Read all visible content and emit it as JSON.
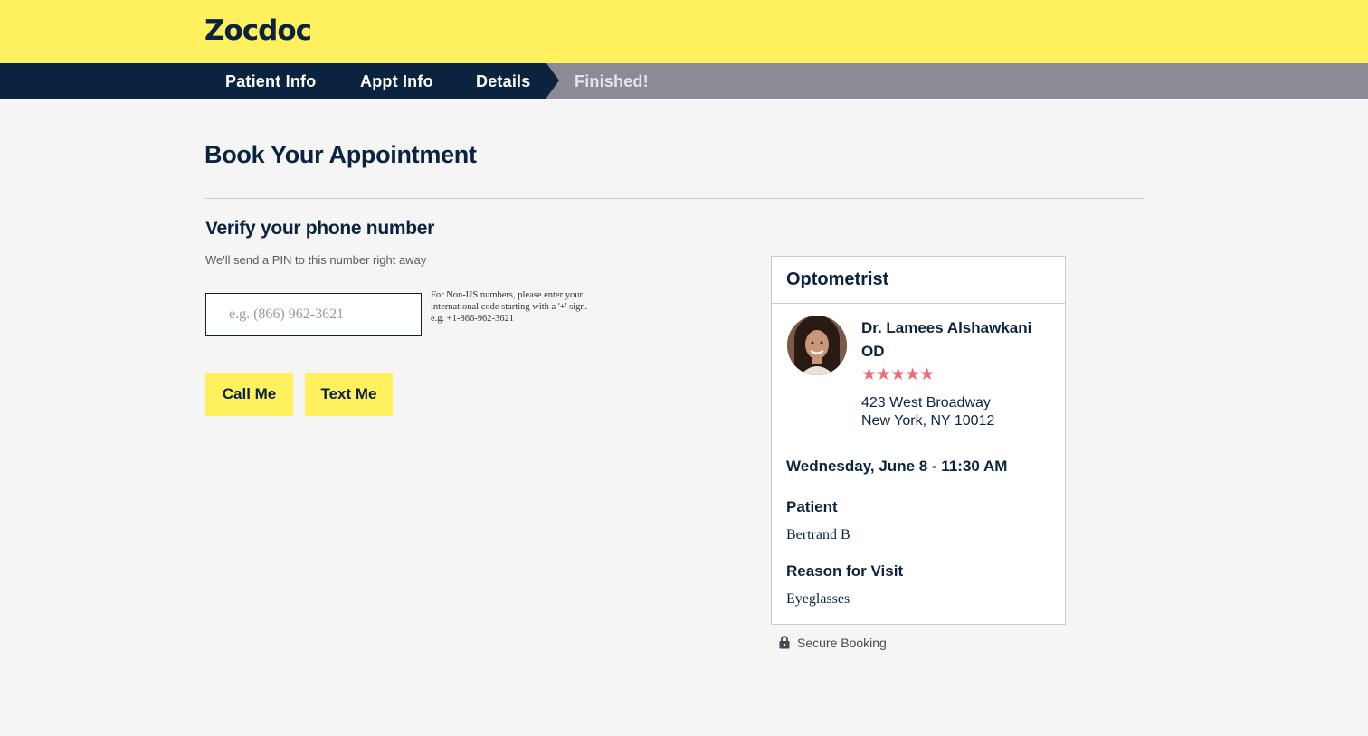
{
  "header": {
    "logo": "Zocdoc",
    "brand_color": "#fff05e"
  },
  "steps": [
    {
      "label": "Patient Info",
      "state": "done"
    },
    {
      "label": "Appt Info",
      "state": "done"
    },
    {
      "label": "Details",
      "state": "current"
    },
    {
      "label": "Finished!",
      "state": "upcoming"
    }
  ],
  "main": {
    "title": "Book Your Appointment",
    "verify": {
      "heading": "Verify your phone number",
      "subtext": "We'll send a PIN to this number right away",
      "phone": {
        "value": "",
        "placeholder": "e.g. (866) 962-3621"
      },
      "note_lines": [
        "For Non-US numbers, please enter your",
        "international code starting with a '+' sign.",
        "e.g. +1-866-962-3621"
      ],
      "call_button": "Call Me",
      "text_button": "Text Me"
    }
  },
  "card": {
    "specialty": "Optometrist",
    "doctor_name": "Dr. Lamees Alshawkani OD",
    "rating": 5,
    "stars": "★★★★★",
    "address_line1": "423 West Broadway",
    "address_line2": "New York, NY 10012",
    "appointment": "Wednesday, June 8 - 11:30 AM",
    "patient_label": "Patient",
    "patient_name": "Bertrand B",
    "reason_label": "Reason for Visit",
    "reason": "Eyeglasses"
  },
  "footer": {
    "secure_text": "Secure Booking",
    "icon": "lock-icon"
  },
  "colors": {
    "navy": "#0c2340",
    "yellow": "#fff05e",
    "star": "#f06a78",
    "step_upcoming_bg": "#8a8b95"
  }
}
